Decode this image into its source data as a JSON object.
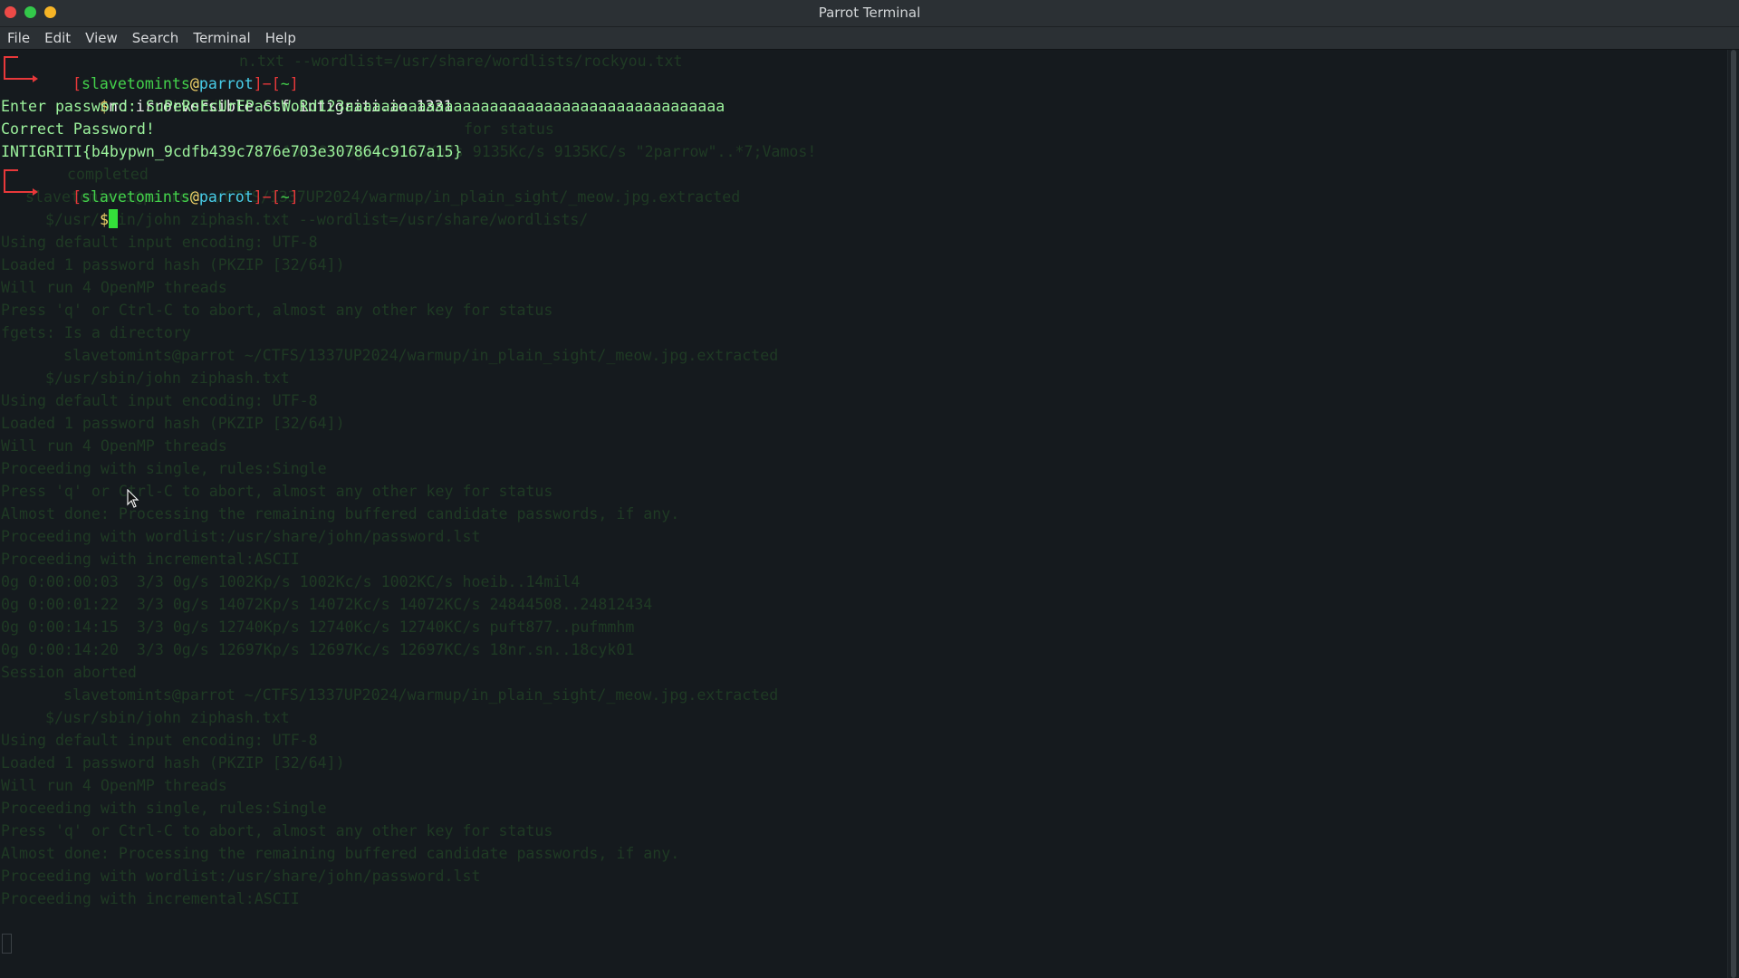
{
  "window": {
    "title": "Parrot Terminal"
  },
  "menu": [
    "File",
    "Edit",
    "View",
    "Search",
    "Terminal",
    "Help"
  ],
  "prompt": {
    "user": "slavetomints",
    "at": "@",
    "host": "parrot",
    "dir": "~",
    "sym": "$"
  },
  "session": {
    "command": "nc irrorversible.ctf.intigriti.io 1331",
    "password_line": "Enter password: SuPeRsEcUrEPaSsWoRd123aaaaaaaaaaaaaaaaaaaaaaaaaaaaaaaaaaaaaaaaaa",
    "correct_line": "Correct Password!",
    "flag_line": "INTIGRITI{b4bypwn_9cdfb439c7876e703e307864c9167a15}"
  },
  "background_lines": [
    "n.txt --wordlist=/usr/share/wordlists/rockyou.txt",
    "threads",
    "for status",
    "-15 10:23) 0g/s 9135Kp/s 9135Kc/s 9135KC/s \"2parrow\"..*7;Vamos!",
    "completed",
    "slavetomints@parrot ~/CTFS/1337UP2024/warmup/in_plain_sight/_meow.jpg.extracted",
    "$/usr/sbin/john ziphash.txt --wordlist=/usr/share/wordlists/",
    "Using default input encoding: UTF-8",
    "Loaded 1 password hash (PKZIP [32/64])",
    "Will run 4 OpenMP threads",
    "Press 'q' or Ctrl-C to abort, almost any other key for status",
    "fgets: Is a directory",
    "slavetomints@parrot ~/CTFS/1337UP2024/warmup/in_plain_sight/_meow.jpg.extracted",
    "$/usr/sbin/john ziphash.txt",
    "Using default input encoding: UTF-8",
    "Loaded 1 password hash (PKZIP [32/64])",
    "Will run 4 OpenMP threads",
    "Proceeding with single, rules:Single",
    "Press 'q' or Ctrl-C to abort, almost any other key for status",
    "Almost done: Processing the remaining buffered candidate passwords, if any.",
    "Proceeding with wordlist:/usr/share/john/password.lst",
    "Proceeding with incremental:ASCII",
    "0g 0:00:00:03  3/3 0g/s 1002Kp/s 1002Kc/s 1002KC/s hoeib..14mil4",
    "0g 0:00:01:22  3/3 0g/s 14072Kp/s 14072Kc/s 14072KC/s 24844508..24812434",
    "0g 0:00:14:15  3/3 0g/s 12740Kp/s 12740Kc/s 12740KC/s puft877..pufmmhm",
    "0g 0:00:14:20  3/3 0g/s 12697Kp/s 12697Kc/s 12697KC/s 18nr.sn..18cyk01",
    "Session aborted",
    "slavetomints@parrot ~/CTFS/1337UP2024/warmup/in_plain_sight/_meow.jpg.extracted",
    "$/usr/sbin/john ziphash.txt",
    "Using default input encoding: UTF-8",
    "Loaded 1 password hash (PKZIP [32/64])",
    "Will run 4 OpenMP threads",
    "Proceeding with single, rules:Single",
    "Press 'q' or Ctrl-C to abort, almost any other key for status",
    "Almost done: Processing the remaining buffered candidate passwords, if any.",
    "Proceeding with wordlist:/usr/share/john/password.lst",
    "Proceeding with incremental:ASCII"
  ],
  "colors": {
    "prompt_bracket": "#e8383a",
    "user": "#43d14b",
    "host": "#48cde8",
    "output": "#9cf29c",
    "cursor": "#34e03a"
  }
}
